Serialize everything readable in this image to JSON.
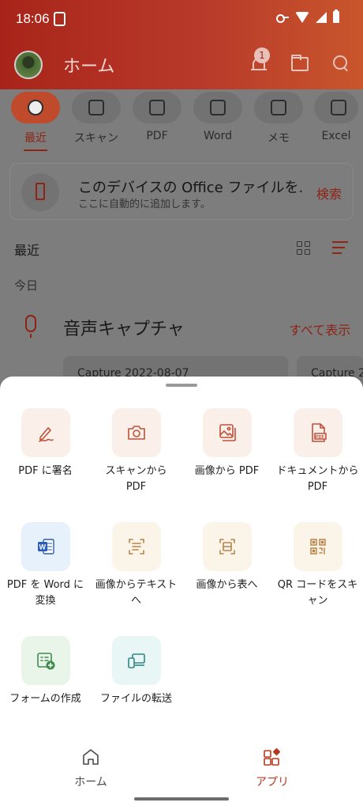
{
  "status_bar": {
    "time": "18:06"
  },
  "header": {
    "title": "ホーム",
    "notification_count": "1"
  },
  "filter_tabs": [
    {
      "label": "最近",
      "active": true
    },
    {
      "label": "スキャン",
      "active": false
    },
    {
      "label": "PDF",
      "active": false
    },
    {
      "label": "Word",
      "active": false
    },
    {
      "label": "メモ",
      "active": false
    },
    {
      "label": "Excel",
      "active": false
    }
  ],
  "info_card": {
    "title": "このデバイスの Office ファイルを...",
    "subtitle": "ここに自動的に追加します。",
    "action": "検索"
  },
  "recent": {
    "label": "最近",
    "today": "今日"
  },
  "voice": {
    "title": "音声キャプチャ",
    "show_all": "すべて表示"
  },
  "captures": [
    "Capture 2022-08-07",
    "Capture 2"
  ],
  "apps": [
    {
      "label": "PDF に署名",
      "icon": "pen-sign-icon",
      "bg": "#fbefea"
    },
    {
      "label": "スキャンから PDF",
      "icon": "camera-icon",
      "bg": "#fbefea"
    },
    {
      "label": "画像から PDF",
      "icon": "images-icon",
      "bg": "#fbefea"
    },
    {
      "label": "ドキュメントから PDF",
      "icon": "pdf-document-icon",
      "bg": "#fbefea"
    },
    {
      "label": "PDF を Word に変換",
      "icon": "word-icon",
      "bg": "#e7f1fb"
    },
    {
      "label": "画像からテキストへ",
      "icon": "text-scan-icon",
      "bg": "#fbf4e9"
    },
    {
      "label": "画像から表へ",
      "icon": "table-scan-icon",
      "bg": "#fbf4e9"
    },
    {
      "label": "QR コードをスキャン",
      "icon": "qr-code-icon",
      "bg": "#fbf4e9"
    },
    {
      "label": "フォームの作成",
      "icon": "form-create-icon",
      "bg": "#eaf5ea"
    },
    {
      "label": "ファイルの転送",
      "icon": "file-transfer-icon",
      "bg": "#e8f6f5"
    }
  ],
  "bottom_nav": [
    {
      "label": "ホーム",
      "icon": "home-icon",
      "active": false
    },
    {
      "label": "アプリ",
      "icon": "apps-icon",
      "active": true
    }
  ],
  "colors": {
    "accent": "#b5391f",
    "header_start": "#a8241a",
    "header_end": "#c8562c"
  }
}
